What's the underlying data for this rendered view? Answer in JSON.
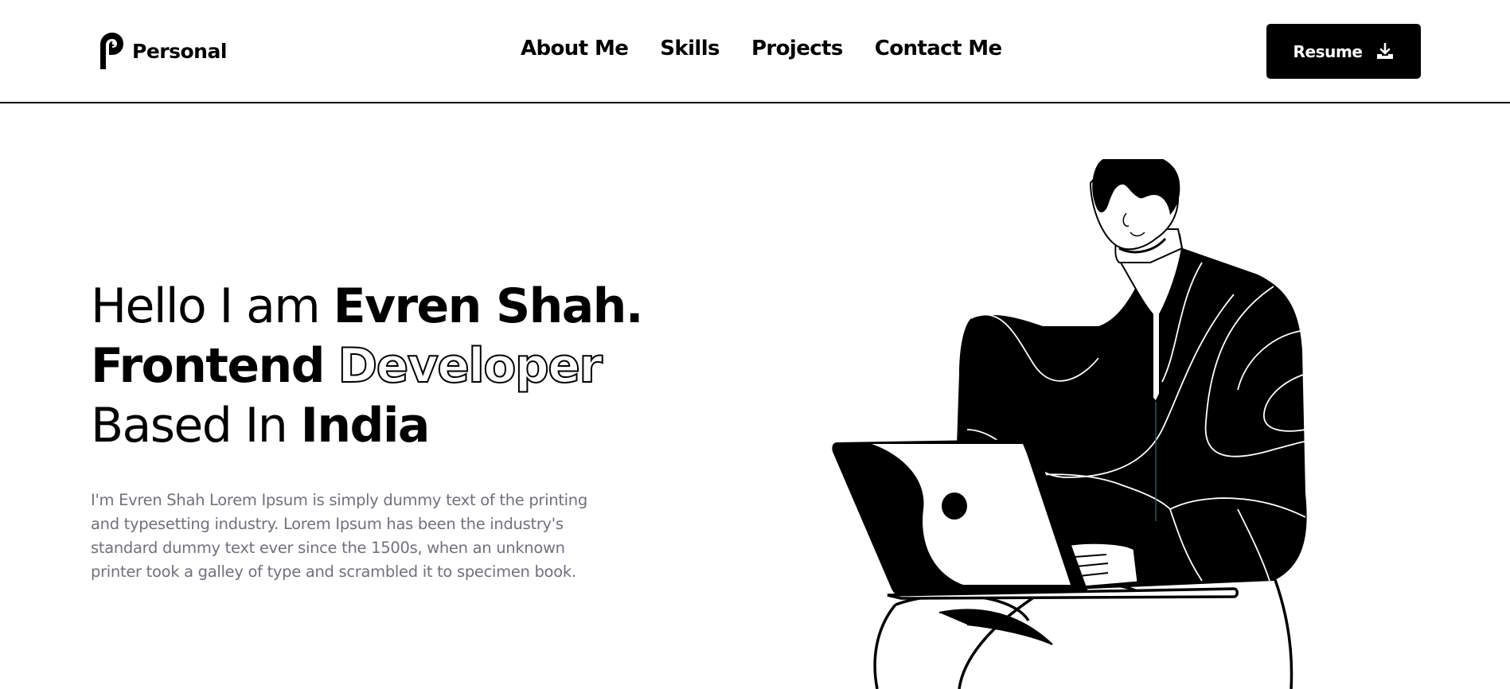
{
  "header": {
    "logo": {
      "icon": "p-logo-icon",
      "text": "Personal"
    },
    "nav": {
      "items": [
        {
          "label": "About Me"
        },
        {
          "label": "Skills"
        },
        {
          "label": "Projects"
        },
        {
          "label": "Contact Me"
        }
      ]
    },
    "resume_button": {
      "label": "Resume",
      "icon": "download-icon",
      "background": "#000000",
      "color": "#ffffff"
    }
  },
  "hero": {
    "heading": {
      "line1": {
        "light": "Hello I am ",
        "bold": "Evren Shah."
      },
      "line2": {
        "bold": "Frontend",
        "outline": "Developer"
      },
      "line3": {
        "light": "Based In ",
        "bold": "India"
      }
    },
    "description": "I'm Evren Shah Lorem Ipsum is simply dummy text of the printing and typesetting industry. Lorem Ipsum has been the industry's standard dummy text ever since the 1500s, when an unknown printer took a galley of type and scrambled it to specimen book.",
    "description_color": "#71717a",
    "illustration": "man-with-laptop-illustration"
  }
}
